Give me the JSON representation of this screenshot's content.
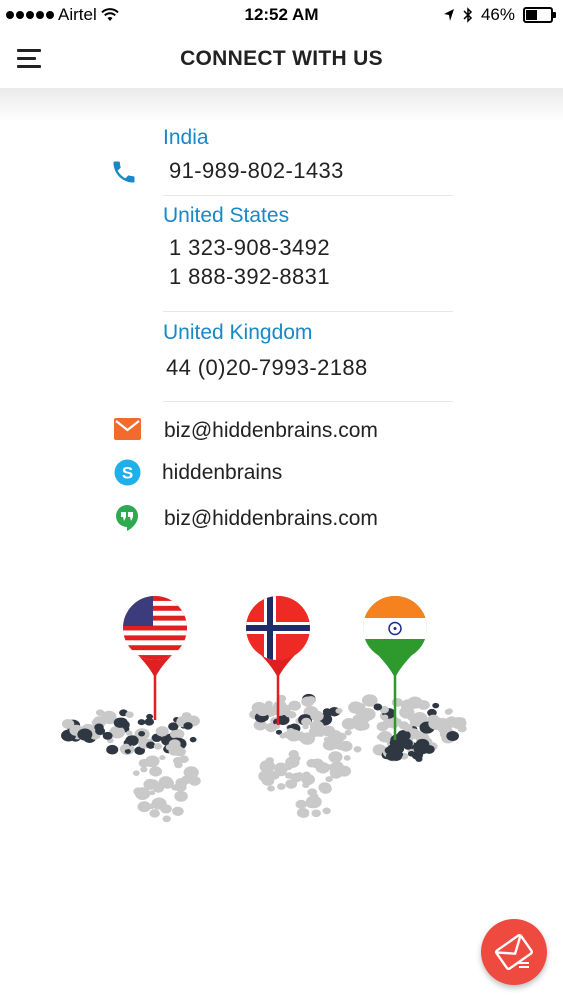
{
  "status_bar": {
    "carrier": "Airtel",
    "time": "12:52 AM",
    "battery": "46%",
    "battery_level": 0.46
  },
  "header": {
    "title": "CONNECT WITH US"
  },
  "offices": [
    {
      "country": "India",
      "phones": [
        "91-989-802-1433"
      ]
    },
    {
      "country": "United States",
      "phones": [
        "1 323-908-3492",
        "1 888-392-8831"
      ]
    },
    {
      "country": "United Kingdom",
      "phones": [
        "44 (0)20-7993-2188"
      ]
    }
  ],
  "contacts": {
    "email": "biz@hiddenbrains.com",
    "skype": "hiddenbrains",
    "hangouts": "biz@hiddenbrains.com"
  },
  "colors": {
    "accent": "#1888c6",
    "email_icon": "#f16b2f",
    "skype_icon": "#1fb0ec",
    "hangouts_icon": "#2da94f",
    "fab": "#ee4a40"
  }
}
